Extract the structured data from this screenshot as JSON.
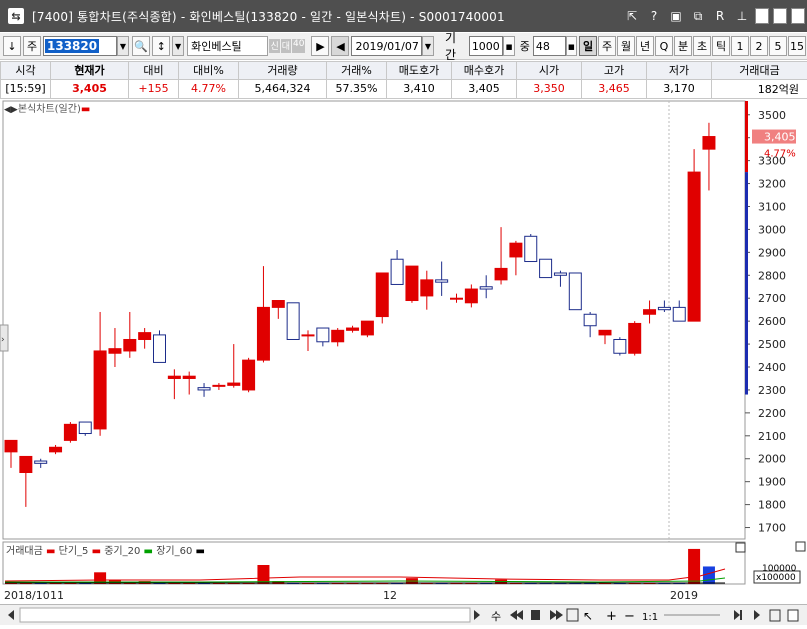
{
  "window": {
    "title": "[7400] 통합차트(주식종합) - 화인베스틸(133820 - 일간 - 일본식차트) - S0001740001",
    "icons": [
      "cursor-icon",
      "help-icon",
      "layout-icon",
      "restore-icon",
      "r-icon",
      "pin-icon",
      "minimize-icon",
      "maximize-icon",
      "close-icon"
    ]
  },
  "toolbar": {
    "down_arrow": "↓",
    "market_type": "주",
    "stock_code": "133820",
    "stock_name": "화인베스틸",
    "tag_sin": "신",
    "tag_dae": "대",
    "tag_40": "40",
    "date": "2019/01/07",
    "period_label": "기간",
    "period_value": "1000",
    "zoom_label": "중",
    "zoom_value": "48",
    "timeframes": [
      "일",
      "주",
      "월",
      "년",
      "Q",
      "분",
      "초",
      "틱",
      "1",
      "2",
      "5",
      "15"
    ],
    "active_timeframe": "일"
  },
  "quote": {
    "headers": [
      "시각",
      "현재가",
      "대비",
      "대비%",
      "거래량",
      "거래%",
      "매도호가",
      "매수호가",
      "시가",
      "고가",
      "저가",
      "거래대금"
    ],
    "values": [
      "[15:59]",
      "3,405",
      "+155",
      "4.77%",
      "5,464,324",
      "57.35%",
      "3,410",
      "3,405",
      "3,350",
      "3,465",
      "3,170",
      "182억원"
    ]
  },
  "chart": {
    "legend": "본식차트(일간)",
    "price_label": "3,405",
    "pct_label": "4.77%",
    "y_ticks": [
      3500,
      3400,
      3300,
      3200,
      3100,
      3000,
      2900,
      2800,
      2700,
      2600,
      2500,
      2400,
      2300,
      2200,
      2100,
      2000,
      1900,
      1800,
      1700
    ],
    "x_labels": [
      "2018/10",
      "11",
      "12",
      "2019"
    ],
    "volume_legend": "거래대금",
    "ma_legend": [
      "단기_5",
      "중기_20",
      "장기_60"
    ],
    "volume_scale_top": "100000",
    "volume_unit": "x100000"
  },
  "chart_data": {
    "type": "candlestick",
    "title": "",
    "ylim": [
      1650,
      3560
    ],
    "candles": [
      {
        "o": 2030,
        "h": 2080,
        "l": 1960,
        "c": 2080
      },
      {
        "o": 1940,
        "h": 2010,
        "l": 1790,
        "c": 2010
      },
      {
        "o": 1990,
        "h": 2000,
        "l": 1960,
        "c": 1980
      },
      {
        "o": 2030,
        "h": 2060,
        "l": 2020,
        "c": 2050
      },
      {
        "o": 2080,
        "h": 2160,
        "l": 2070,
        "c": 2150
      },
      {
        "o": 2160,
        "h": 2150,
        "l": 2100,
        "c": 2110
      },
      {
        "o": 2130,
        "h": 2640,
        "l": 2100,
        "c": 2470
      },
      {
        "o": 2460,
        "h": 2570,
        "l": 2400,
        "c": 2480
      },
      {
        "o": 2470,
        "h": 2640,
        "l": 2440,
        "c": 2520
      },
      {
        "o": 2520,
        "h": 2570,
        "l": 2480,
        "c": 2550
      },
      {
        "o": 2540,
        "h": 2560,
        "l": 2420,
        "c": 2420
      },
      {
        "o": 2350,
        "h": 2390,
        "l": 2260,
        "c": 2360
      },
      {
        "o": 2350,
        "h": 2380,
        "l": 2280,
        "c": 2360
      },
      {
        "o": 2310,
        "h": 2330,
        "l": 2270,
        "c": 2300
      },
      {
        "o": 2320,
        "h": 2330,
        "l": 2300,
        "c": 2320
      },
      {
        "o": 2320,
        "h": 2500,
        "l": 2310,
        "c": 2330
      },
      {
        "o": 2300,
        "h": 2440,
        "l": 2290,
        "c": 2430
      },
      {
        "o": 2430,
        "h": 2840,
        "l": 2420,
        "c": 2660
      },
      {
        "o": 2660,
        "h": 2690,
        "l": 2610,
        "c": 2690
      },
      {
        "o": 2680,
        "h": 2680,
        "l": 2530,
        "c": 2520
      },
      {
        "o": 2540,
        "h": 2560,
        "l": 2470,
        "c": 2540
      },
      {
        "o": 2570,
        "h": 2560,
        "l": 2490,
        "c": 2510
      },
      {
        "o": 2510,
        "h": 2570,
        "l": 2490,
        "c": 2560
      },
      {
        "o": 2560,
        "h": 2580,
        "l": 2550,
        "c": 2570
      },
      {
        "o": 2540,
        "h": 2600,
        "l": 2530,
        "c": 2600
      },
      {
        "o": 2620,
        "h": 2810,
        "l": 2590,
        "c": 2810
      },
      {
        "o": 2870,
        "h": 2910,
        "l": 2760,
        "c": 2760
      },
      {
        "o": 2690,
        "h": 2840,
        "l": 2680,
        "c": 2840
      },
      {
        "o": 2710,
        "h": 2820,
        "l": 2650,
        "c": 2780
      },
      {
        "o": 2780,
        "h": 2860,
        "l": 2710,
        "c": 2770
      },
      {
        "o": 2700,
        "h": 2720,
        "l": 2680,
        "c": 2700
      },
      {
        "o": 2680,
        "h": 2760,
        "l": 2660,
        "c": 2740
      },
      {
        "o": 2750,
        "h": 2800,
        "l": 2700,
        "c": 2740
      },
      {
        "o": 2780,
        "h": 3010,
        "l": 2760,
        "c": 2830
      },
      {
        "o": 2880,
        "h": 2950,
        "l": 2800,
        "c": 2940
      },
      {
        "o": 2970,
        "h": 2980,
        "l": 2860,
        "c": 2860
      },
      {
        "o": 2870,
        "h": 2870,
        "l": 2790,
        "c": 2790
      },
      {
        "o": 2810,
        "h": 2820,
        "l": 2750,
        "c": 2800
      },
      {
        "o": 2810,
        "h": 2810,
        "l": 2650,
        "c": 2650
      },
      {
        "o": 2630,
        "h": 2640,
        "l": 2530,
        "c": 2580
      },
      {
        "o": 2540,
        "h": 2560,
        "l": 2500,
        "c": 2560
      },
      {
        "o": 2520,
        "h": 2530,
        "l": 2450,
        "c": 2460
      },
      {
        "o": 2460,
        "h": 2600,
        "l": 2450,
        "c": 2590
      },
      {
        "o": 2630,
        "h": 2690,
        "l": 2590,
        "c": 2650
      },
      {
        "o": 2660,
        "h": 2690,
        "l": 2640,
        "c": 2650
      },
      {
        "o": 2660,
        "h": 2690,
        "l": 2600,
        "c": 2600
      },
      {
        "o": 2600,
        "h": 3350,
        "l": 2600,
        "c": 3250
      },
      {
        "o": 3350,
        "h": 3465,
        "l": 3170,
        "c": 3405
      }
    ],
    "volumes": [
      1,
      1,
      1,
      1,
      1,
      1,
      8,
      3,
      1,
      2,
      1,
      1,
      1,
      1,
      1,
      1,
      1,
      13,
      2,
      1,
      1,
      1,
      1,
      1,
      1,
      1,
      1,
      4,
      1,
      1,
      1,
      1,
      1,
      3,
      1,
      1,
      1,
      1,
      1,
      1,
      1,
      1,
      1,
      1,
      1,
      1,
      24,
      12
    ],
    "colors": {
      "up": "#e00000",
      "down": "#1c2c8a",
      "grid": "#d0d0d0"
    }
  }
}
